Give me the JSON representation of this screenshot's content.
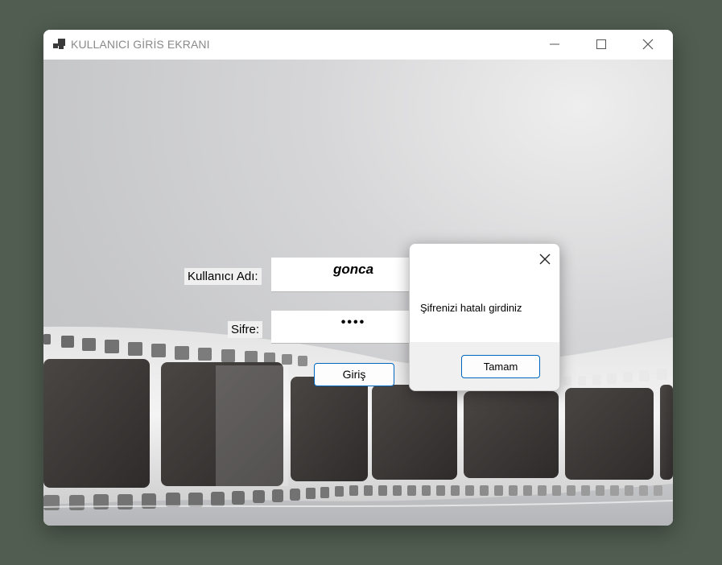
{
  "window": {
    "title": "KULLANICI GİRİS EKRANI",
    "icons": {
      "app": "app-icon",
      "minimize": "minimize-icon",
      "maximize": "maximize-icon",
      "close": "close-icon"
    }
  },
  "login": {
    "username_label": "Kullanıcı Adı:",
    "username_value": "gonca",
    "password_label": "Sifre:",
    "password_value": "••••",
    "submit_label": "Giriş"
  },
  "dialog": {
    "message": "Şifrenizi hatalı girdiniz",
    "ok_label": "Tamam",
    "close_icon": "close-icon"
  },
  "colors": {
    "accent": "#0067c0",
    "desktop": "#515d51",
    "dialog_footer": "#f0f0f0"
  }
}
